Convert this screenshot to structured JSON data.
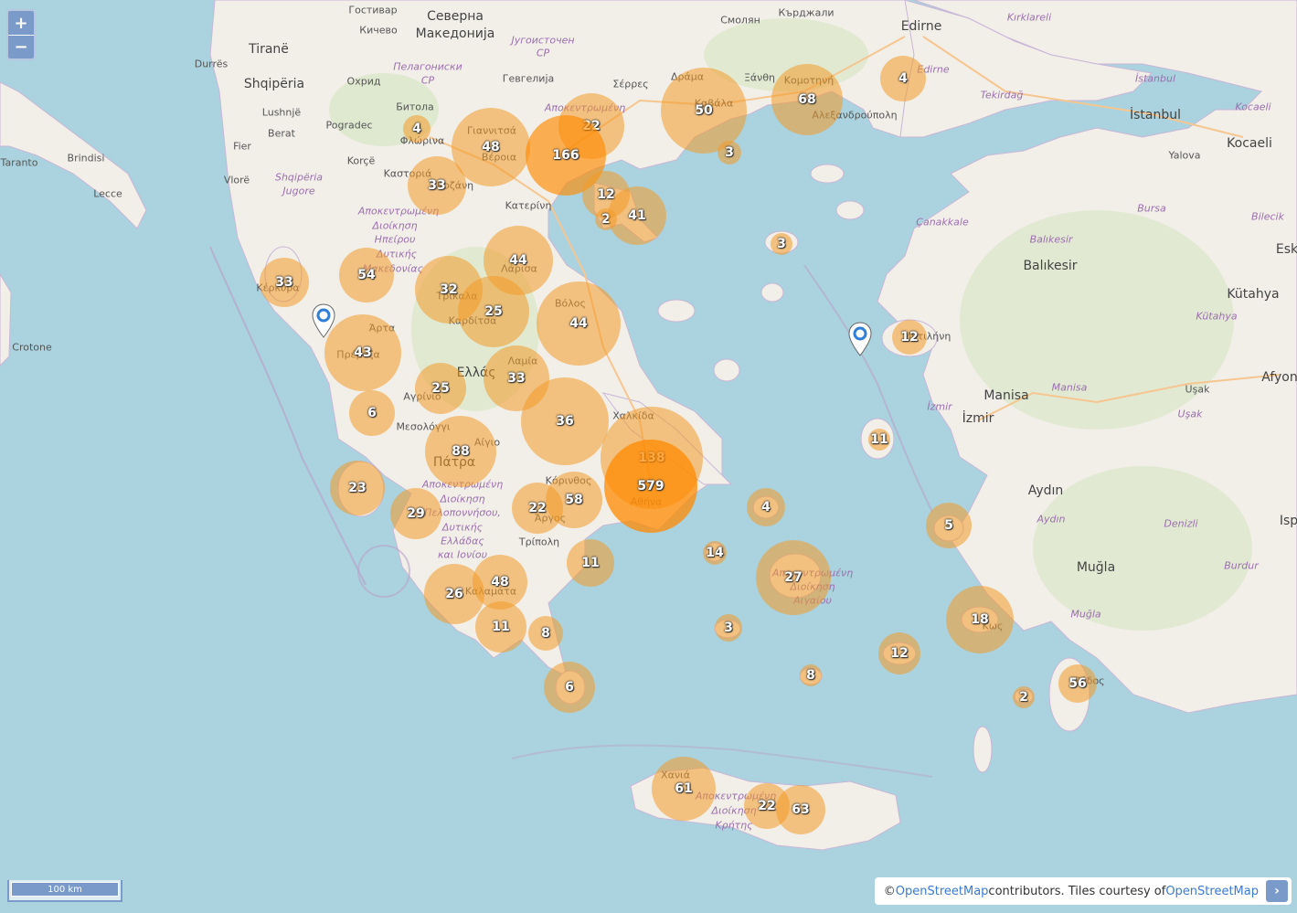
{
  "map": {
    "zoom_in_label": "+",
    "zoom_out_label": "−",
    "scale_label": "100 km",
    "attribution": {
      "prefix": "© ",
      "osm_link": "OpenStreetMap",
      "middle": " contributors. Tiles courtesy of ",
      "tiles_link": "OpenStreetMap",
      "toggle": "›"
    },
    "colors": {
      "sea": "#aad3df",
      "land": "#f2efe9",
      "cluster_fill": "#f39a28",
      "cluster_fill_alpha": 0.55,
      "cluster_hot": "#ff8a00",
      "marker": "#2f7ed8"
    },
    "place_labels": [
      {
        "text": "Гостивар"
      },
      {
        "text": "Северна"
      },
      {
        "text": "Македонија"
      },
      {
        "text": "Кичево"
      },
      {
        "text": "Југоисточен"
      },
      {
        "text": "СР"
      },
      {
        "text": "Смолян"
      },
      {
        "text": "Кърджали"
      },
      {
        "text": "Edirne"
      },
      {
        "text": "Kırklareli"
      },
      {
        "text": "Tiranë"
      },
      {
        "text": "Durrës"
      },
      {
        "text": "Shqipëria"
      },
      {
        "text": "Охрид"
      },
      {
        "text": "Пелагониски"
      },
      {
        "text": "СР"
      },
      {
        "text": "Гевгелија"
      },
      {
        "text": "Σέρρες"
      },
      {
        "text": "Δράμα"
      },
      {
        "text": "Ξάνθη"
      },
      {
        "text": "Κομοτηνή"
      },
      {
        "text": "Edirne"
      },
      {
        "text": "Tekirdağ"
      },
      {
        "text": "İstanbul"
      },
      {
        "text": "İstanbul"
      },
      {
        "text": "Kocaeli"
      },
      {
        "text": "Kocaeli"
      },
      {
        "text": "Lushnjë"
      },
      {
        "text": "Битола"
      },
      {
        "text": "Pogradec"
      },
      {
        "text": "Αποκεντρωμένη"
      },
      {
        "text": "Καβάλα"
      },
      {
        "text": "Αλεξανδρούπολη"
      },
      {
        "text": "Berat"
      },
      {
        "text": "Φλώρινα"
      },
      {
        "text": "Γιαννιτσά"
      },
      {
        "text": "Βέροια"
      },
      {
        "text": "Fier"
      },
      {
        "text": "Korçë"
      },
      {
        "text": "Yalova"
      },
      {
        "text": "Taranto"
      },
      {
        "text": "Brindisi"
      },
      {
        "text": "Vlorë"
      },
      {
        "text": "Shqipëria"
      },
      {
        "text": "Jugore"
      },
      {
        "text": "Καστοριά"
      },
      {
        "text": "Κοζάνη"
      },
      {
        "text": "Lecce"
      },
      {
        "text": "Κατερίνη"
      },
      {
        "text": "Bursa"
      },
      {
        "text": "Αποκεντρωμένη"
      },
      {
        "text": "Διοίκηση"
      },
      {
        "text": "Ηπείρου"
      },
      {
        "text": "Δυτικής"
      },
      {
        "text": "Μακεδονίας"
      },
      {
        "text": "Çanakkale"
      },
      {
        "text": "Bilecik"
      },
      {
        "text": "Balıkesir"
      },
      {
        "text": "Balıkesir"
      },
      {
        "text": "Λάρισα"
      },
      {
        "text": "Κέρκυρα"
      },
      {
        "text": "Τρίκαλα"
      },
      {
        "text": "Καρδίτσα"
      },
      {
        "text": "Βόλος"
      },
      {
        "text": "Kütahya"
      },
      {
        "text": "Kütahya"
      },
      {
        "text": "Άρτα"
      },
      {
        "text": "Πρέβεζα"
      },
      {
        "text": "Μυτιλήνη"
      },
      {
        "text": "Crotone"
      },
      {
        "text": "Λαμία"
      },
      {
        "text": "Ελλάς"
      },
      {
        "text": "Αγρίνιο"
      },
      {
        "text": "Afyon"
      },
      {
        "text": "Manisa"
      },
      {
        "text": "Manisa"
      },
      {
        "text": "Uşak"
      },
      {
        "text": "Uşak"
      },
      {
        "text": "İzmir"
      },
      {
        "text": "İzmir"
      },
      {
        "text": "Χαλκίδα"
      },
      {
        "text": "Μεσολόγγι"
      },
      {
        "text": "Αίγιο"
      },
      {
        "text": "Πάτρα"
      },
      {
        "text": "Κόρινθος"
      },
      {
        "text": "Αποκεντρωμένη"
      },
      {
        "text": "Διοίκηση"
      },
      {
        "text": "Πελοποννήσου,"
      },
      {
        "text": "Δυτικής"
      },
      {
        "text": "Ελλάδας"
      },
      {
        "text": "και Ιονίου"
      },
      {
        "text": "Άργος"
      },
      {
        "text": "Τρίπολη"
      },
      {
        "text": "Aydın"
      },
      {
        "text": "Aydın"
      },
      {
        "text": "Denizli"
      },
      {
        "text": "Αθήνα"
      },
      {
        "text": "Muğla"
      },
      {
        "text": "Muğla"
      },
      {
        "text": "Burdur"
      },
      {
        "text": "Αποκεντρωμένη"
      },
      {
        "text": "Διοίκηση"
      },
      {
        "text": "Αιγαίου"
      },
      {
        "text": "Κως"
      },
      {
        "text": "Καλαμάτα"
      },
      {
        "text": "Ρόδος"
      },
      {
        "text": "Χανιά"
      },
      {
        "text": "Αποκεντρωμένη"
      },
      {
        "text": "Διοίκηση"
      },
      {
        "text": "Κρήτης"
      },
      {
        "text": "Isp"
      },
      {
        "text": "Esk"
      }
    ],
    "clusters": [
      {
        "count": "22"
      },
      {
        "count": "4"
      },
      {
        "count": "48"
      },
      {
        "count": "166"
      },
      {
        "count": "50"
      },
      {
        "count": "68"
      },
      {
        "count": "4"
      },
      {
        "count": "3"
      },
      {
        "count": "33"
      },
      {
        "count": "12"
      },
      {
        "count": "2"
      },
      {
        "count": "41"
      },
      {
        "count": "3"
      },
      {
        "count": "33"
      },
      {
        "count": "54"
      },
      {
        "count": "44"
      },
      {
        "count": "32"
      },
      {
        "count": "25"
      },
      {
        "count": "44"
      },
      {
        "count": "43"
      },
      {
        "count": "12"
      },
      {
        "count": "6"
      },
      {
        "count": "25"
      },
      {
        "count": "33"
      },
      {
        "count": "36"
      },
      {
        "count": "11"
      },
      {
        "count": "88"
      },
      {
        "count": "138"
      },
      {
        "count": "579"
      },
      {
        "count": "23"
      },
      {
        "count": "29"
      },
      {
        "count": "22"
      },
      {
        "count": "58"
      },
      {
        "count": "4"
      },
      {
        "count": "5"
      },
      {
        "count": "11"
      },
      {
        "count": "14"
      },
      {
        "count": "27"
      },
      {
        "count": "48"
      },
      {
        "count": "26"
      },
      {
        "count": "18"
      },
      {
        "count": "11"
      },
      {
        "count": "8"
      },
      {
        "count": "3"
      },
      {
        "count": "12"
      },
      {
        "count": "8"
      },
      {
        "count": "56"
      },
      {
        "count": "2"
      },
      {
        "count": "6"
      },
      {
        "count": "61"
      },
      {
        "count": "22"
      },
      {
        "count": "63"
      }
    ],
    "markers": [
      {
        "name": "location-marker-ionian"
      },
      {
        "name": "location-marker-lesvos"
      }
    ]
  }
}
